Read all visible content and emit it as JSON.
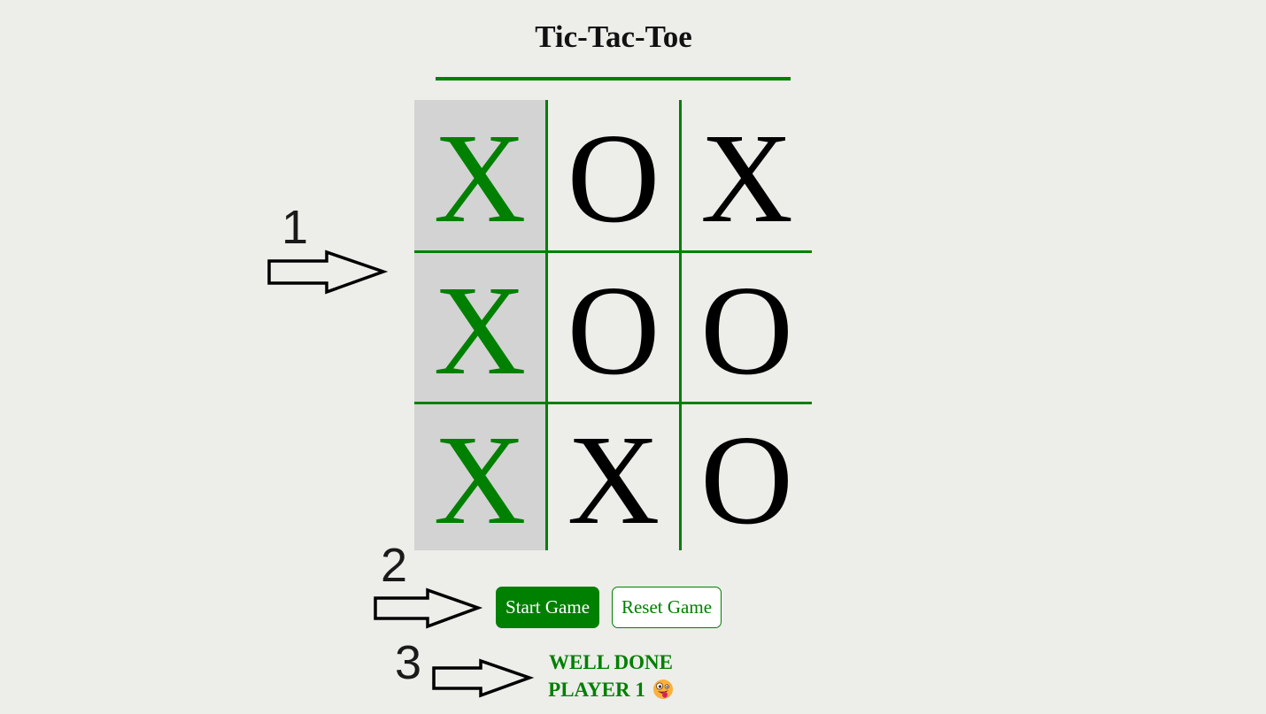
{
  "title": "Tic-Tac-Toe",
  "board": {
    "cells": [
      {
        "mark": "X",
        "winning": true
      },
      {
        "mark": "O",
        "winning": false
      },
      {
        "mark": "X",
        "winning": false
      },
      {
        "mark": "X",
        "winning": true
      },
      {
        "mark": "O",
        "winning": false
      },
      {
        "mark": "O",
        "winning": false
      },
      {
        "mark": "X",
        "winning": true
      },
      {
        "mark": "X",
        "winning": false
      },
      {
        "mark": "O",
        "winning": false
      }
    ]
  },
  "controls": {
    "start_label": "Start Game",
    "reset_label": "Reset Game"
  },
  "status": {
    "line1": "WELL DONE",
    "line2": "PLAYER 1"
  },
  "annotations": {
    "one": "1",
    "two": "2",
    "three": "3"
  },
  "colors": {
    "accent": "#008000",
    "background": "#ededea",
    "winning_cell": "#d3d3d3"
  },
  "icons": {
    "status_emoji": "zany-face-icon",
    "annotation_arrow": "outline-right-arrow-icon"
  }
}
